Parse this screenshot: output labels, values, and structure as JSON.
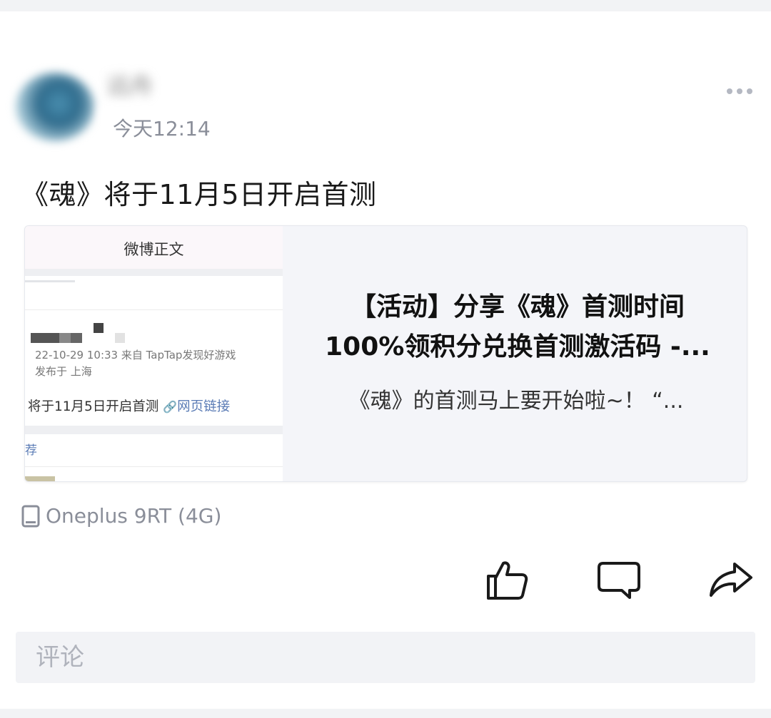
{
  "header": {
    "username": "远舟",
    "time": "今天12:14"
  },
  "post": {
    "text": "《魂》将于11月5日开启首测"
  },
  "link_card": {
    "thumbnail": {
      "header": "微博正文",
      "meta_line1": "22-10-29 10:33  来自 TapTap发现好游戏",
      "meta_line2": "发布于 上海",
      "post_text": "将于11月5日开启首测",
      "link_icon": "🔗",
      "link_text": "网页链接",
      "section_label": "荐"
    },
    "title_line1": "【活动】分享《魂》首测时间",
    "title_line2": "100%领积分兑换首测激活码 -...",
    "description": "《魂》的首测马上要开始啦~！ “..."
  },
  "device": {
    "icon": "phone-icon",
    "label": "Oneplus 9RT (4G)"
  },
  "actions": {
    "like_icon": "thumbs-up-icon",
    "comment_icon": "comment-icon",
    "share_icon": "share-icon"
  },
  "comment": {
    "placeholder": "评论"
  },
  "colors": {
    "icon_dark": "#1a1a1a",
    "muted_text": "#8a8e99",
    "link_blue": "#5a7bb5",
    "card_bg": "#f4f5f9"
  }
}
